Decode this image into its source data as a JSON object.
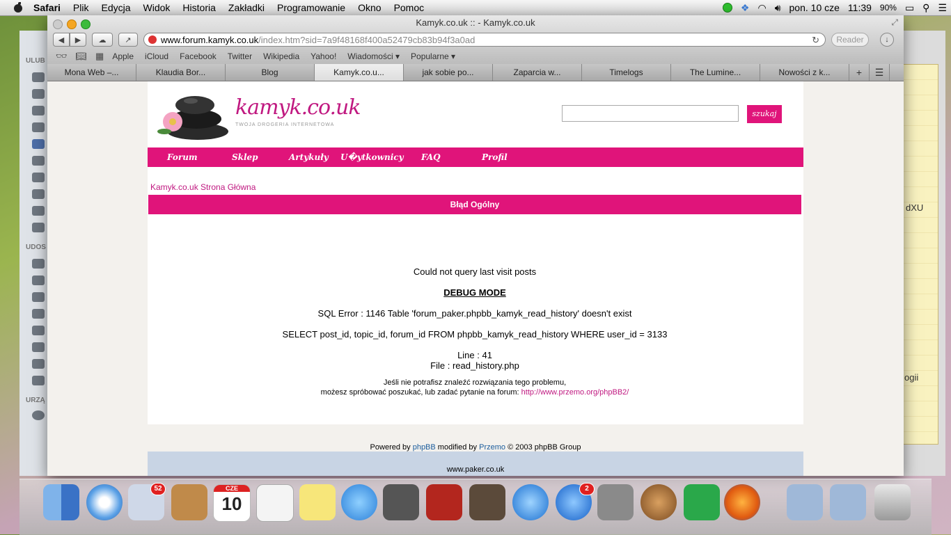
{
  "menubar": {
    "app": "Safari",
    "items": [
      "Plik",
      "Edycja",
      "Widok",
      "Historia",
      "Zakładki",
      "Programowanie",
      "Okno",
      "Pomoc"
    ],
    "date": "pon. 10 cze",
    "time": "11:39",
    "battery": "90%"
  },
  "finder": {
    "sections": [
      "ULUB",
      "UDOS",
      "URZĄ"
    ]
  },
  "notes": {
    "lines": [
      "dXU",
      "ogii"
    ]
  },
  "window": {
    "title": "Kamyk.co.uk :: - Kamyk.co.uk",
    "url_host": "www.forum.kamyk.co.uk",
    "url_rest": "/index.htm?sid=7a9f48168f400a52479cb83b94f3a0ad",
    "reader_label": "Reader"
  },
  "bookmarks": [
    "Apple",
    "iCloud",
    "Facebook",
    "Twitter",
    "Wikipedia",
    "Yahoo!",
    "Wiadomości ▾",
    "Popularne ▾"
  ],
  "tabs": [
    {
      "label": "Mona Web –..."
    },
    {
      "label": "Klaudia Bor..."
    },
    {
      "label": "Blog"
    },
    {
      "label": "Kamyk.co.u..."
    },
    {
      "label": "jak sobie po..."
    },
    {
      "label": "Zaparcia w..."
    },
    {
      "label": "Timelogs"
    },
    {
      "label": "The Lumine..."
    },
    {
      "label": "Nowości z k..."
    }
  ],
  "site": {
    "logo": "kamyk.co.uk",
    "tagline": "TWOJA DROGERIA INTERNETOWA",
    "search_button": "szukaj",
    "nav": [
      "Forum",
      "Sklep",
      "Artykuły",
      "U�ytkownicy",
      "FAQ",
      "Profil"
    ],
    "breadcrumb": "Kamyk.co.uk Strona Główna",
    "error_title": "Błąd Ogólny",
    "msg1": "Could not query last visit posts",
    "debug": "DEBUG MODE",
    "sql_error": "SQL Error : 1146 Table 'forum_paker.phpbb_kamyk_read_history' doesn't exist",
    "query": "SELECT post_id, topic_id, forum_id FROM phpbb_kamyk_read_history WHERE user_id = 3133",
    "line": "Line : 41",
    "file": "File : read_history.php",
    "help1": "Jeśli nie potrafisz znaleźć rozwiązania tego problemu,",
    "help2": "możesz spróbować poszukać, lub zadać pytanie na forum:",
    "help_link": "http://www.przemo.org/phpBB2/",
    "powered_pre": "Powered by",
    "powered_phpbb": "phpBB",
    "powered_mid": "modified by",
    "powered_przemo": "Przemo",
    "powered_post": "© 2003 phpBB Group",
    "footer_site": "www.paker.co.uk"
  },
  "dock": {
    "mail_badge": "52",
    "calendar_month": "CZE",
    "calendar_day": "10",
    "appstore_badge": "2"
  }
}
